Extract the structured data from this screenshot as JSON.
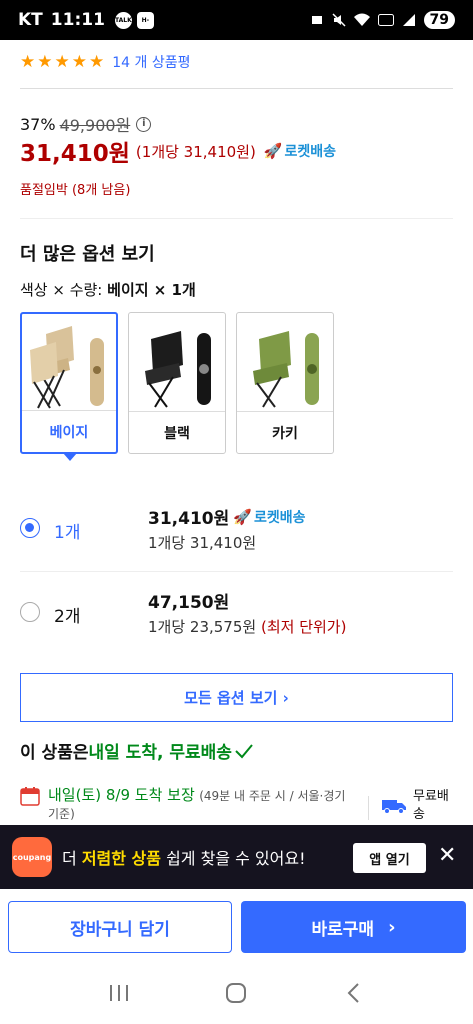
{
  "status_bar": {
    "carrier": "KT",
    "time": "11:11",
    "app1": "TALK",
    "app2": "H-Point",
    "battery": "79"
  },
  "product": {
    "rating_count": "14 개 상품평",
    "discount": "37%",
    "original_price": "49,900원",
    "sale_price": "31,410원",
    "unit_price": "(1개당 31,410원)",
    "rocket_label": "로켓배송",
    "stock_status": "품절임박 (8개 남음)"
  },
  "options": {
    "section_title": "더 많은 옵션 보기",
    "summary_prefix": "색상 × 수량: ",
    "summary_value": "베이지 × 1개",
    "colors": [
      {
        "label": "베이지",
        "color": "#d9c29a"
      },
      {
        "label": "블랙",
        "color": "#1c1c1c"
      },
      {
        "label": "카키",
        "color": "#7f9a46"
      }
    ],
    "quantities": [
      {
        "label": "1개",
        "price": "31,410원",
        "rocket": "로켓배송",
        "unit": "1개당 31,410원",
        "note": ""
      },
      {
        "label": "2개",
        "price": "47,150원",
        "rocket": "",
        "unit": "1개당 23,575원",
        "note": "(최저 단위가)"
      }
    ],
    "all_options_label": "모든 옵션 보기 ›"
  },
  "delivery": {
    "title_prefix": "이 상품은 ",
    "title_highlight": "내일 도착, 무료배송",
    "arrival": "내일(토) 8/9 도착 보장",
    "arrival_note": "(49분 내 주문 시 / 서울·경기 기준)",
    "free_shipping": "무료배송"
  },
  "banner": {
    "logo_text": "coupang",
    "text_before": "더 ",
    "text_highlight": "저렴한 상품",
    "text_after": " 쉽게 찾을 수 있어요!",
    "open_app": "앱 열기"
  },
  "actions": {
    "cart": "장바구니 담기",
    "buy": "바로구매"
  },
  "colors": {
    "accent": "#346aff",
    "price_red": "#ae0000",
    "rocket": "#1c91d7",
    "green": "#00891a"
  }
}
